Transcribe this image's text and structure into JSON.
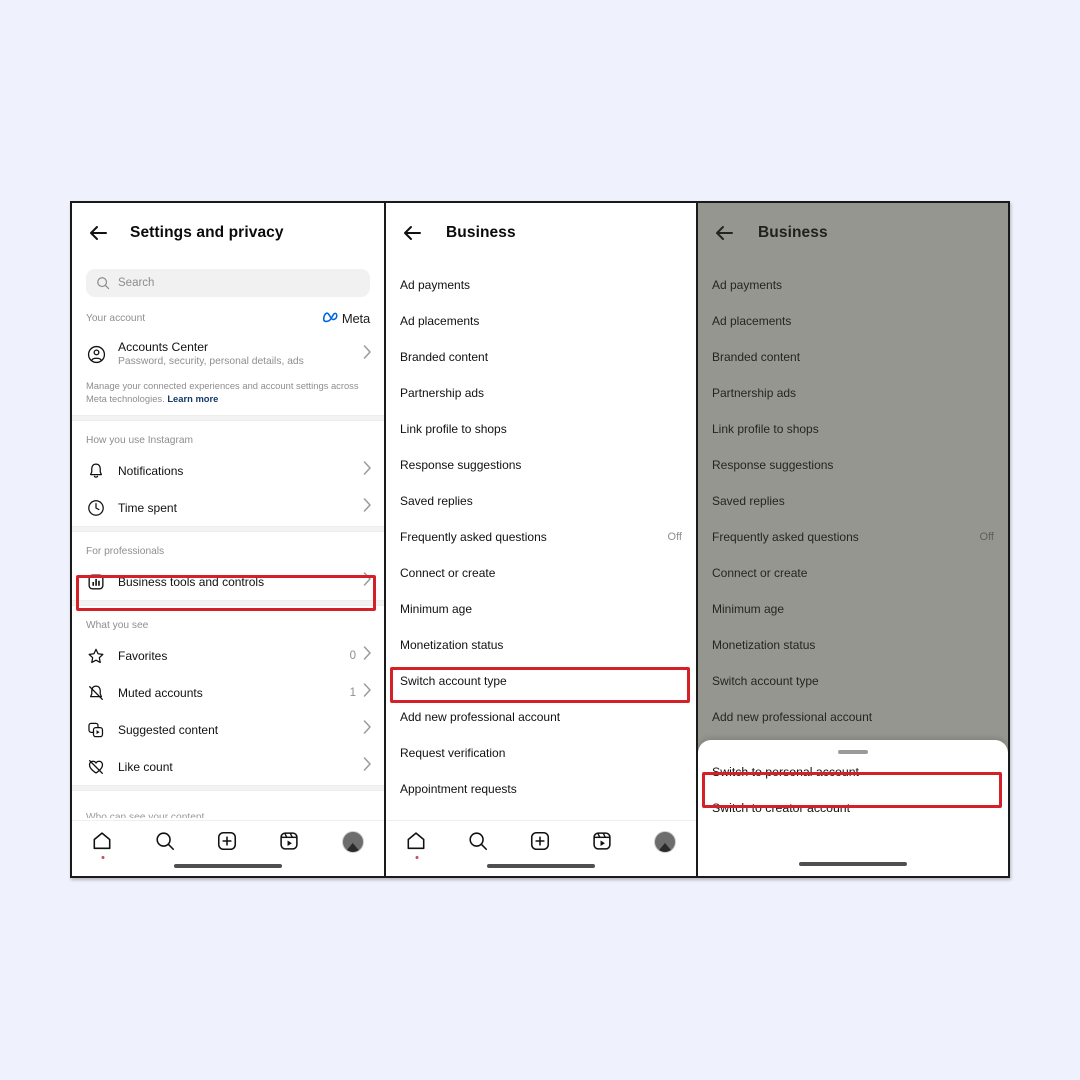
{
  "background_color": "#eff2fc",
  "accent_highlight_color": "#d42027",
  "meta_blue": "#0064e0",
  "panel1": {
    "header": {
      "title": "Settings and privacy",
      "back_icon": "back-arrow-icon"
    },
    "search": {
      "placeholder": "Search",
      "icon": "search-icon"
    },
    "section_account": {
      "label": "Your account",
      "brand": "Meta",
      "brand_icon": "meta-infinity-icon"
    },
    "accounts_center": {
      "icon": "account-circle-icon",
      "title": "Accounts Center",
      "subtitle": "Password, security, personal details, ads",
      "chevron": "chevron-right-icon"
    },
    "note": "Manage your connected experiences and account settings across Meta technologies.",
    "note_link": "Learn more",
    "section_usage": {
      "label": "How you use Instagram"
    },
    "usage_items": [
      {
        "label": "Notifications",
        "icon": "bell-icon",
        "meta": "",
        "chevron": "chevron-right-icon"
      },
      {
        "label": "Time spent",
        "icon": "clock-icon",
        "meta": "",
        "chevron": "chevron-right-icon"
      }
    ],
    "section_professionals": {
      "label": "For professionals"
    },
    "professional_items": [
      {
        "label": "Business tools and controls",
        "icon": "bar-chart-square-icon",
        "meta": "",
        "chevron": "chevron-right-icon",
        "highlighted": true
      }
    ],
    "section_whatyousee": {
      "label": "What you see"
    },
    "whatyousee_items": [
      {
        "label": "Favorites",
        "icon": "star-icon",
        "meta": "0",
        "chevron": "chevron-right-icon"
      },
      {
        "label": "Muted accounts",
        "icon": "bell-slash-icon",
        "meta": "1",
        "chevron": "chevron-right-icon"
      },
      {
        "label": "Suggested content",
        "icon": "suggested-content-icon",
        "meta": "",
        "chevron": "chevron-right-icon"
      },
      {
        "label": "Like count",
        "icon": "heart-slash-icon",
        "meta": "",
        "chevron": "chevron-right-icon"
      }
    ],
    "cut_off_section": "Who can see your content"
  },
  "panel2": {
    "header": {
      "title": "Business",
      "back_icon": "back-arrow-icon"
    },
    "items": [
      {
        "label": "Ad payments",
        "meta": ""
      },
      {
        "label": "Ad placements",
        "meta": ""
      },
      {
        "label": "Branded content",
        "meta": ""
      },
      {
        "label": "Partnership ads",
        "meta": ""
      },
      {
        "label": "Link profile to shops",
        "meta": ""
      },
      {
        "label": "Response suggestions",
        "meta": ""
      },
      {
        "label": "Saved replies",
        "meta": ""
      },
      {
        "label": "Frequently asked questions",
        "meta": "Off"
      },
      {
        "label": "Connect or create",
        "meta": ""
      },
      {
        "label": "Minimum age",
        "meta": ""
      },
      {
        "label": "Monetization status",
        "meta": ""
      },
      {
        "label": "Switch account type",
        "meta": "",
        "highlighted": true
      },
      {
        "label": "Add new professional account",
        "meta": ""
      },
      {
        "label": "Request verification",
        "meta": ""
      },
      {
        "label": "Appointment requests",
        "meta": ""
      }
    ]
  },
  "panel3": {
    "header": {
      "title": "Business",
      "back_icon": "back-arrow-icon"
    },
    "dimmed": true,
    "items": [
      {
        "label": "Ad payments",
        "meta": ""
      },
      {
        "label": "Ad placements",
        "meta": ""
      },
      {
        "label": "Branded content",
        "meta": ""
      },
      {
        "label": "Partnership ads",
        "meta": ""
      },
      {
        "label": "Link profile to shops",
        "meta": ""
      },
      {
        "label": "Response suggestions",
        "meta": ""
      },
      {
        "label": "Saved replies",
        "meta": ""
      },
      {
        "label": "Frequently asked questions",
        "meta": "Off"
      },
      {
        "label": "Connect or create",
        "meta": ""
      },
      {
        "label": "Minimum age",
        "meta": ""
      },
      {
        "label": "Monetization status",
        "meta": ""
      },
      {
        "label": "Switch account type",
        "meta": ""
      },
      {
        "label": "Add new professional account",
        "meta": ""
      }
    ],
    "sheet": {
      "handle": "drag-handle",
      "options": [
        {
          "label": "Switch to personal account",
          "highlighted": true
        },
        {
          "label": "Switch to creator account",
          "highlighted": false
        }
      ]
    }
  },
  "bottom_nav": {
    "items": [
      {
        "icon": "home-icon",
        "has_dot": true
      },
      {
        "icon": "search-icon",
        "has_dot": false
      },
      {
        "icon": "create-plus-icon",
        "has_dot": false
      },
      {
        "icon": "reels-icon",
        "has_dot": false
      },
      {
        "icon": "profile-avatar-icon",
        "has_dot": false
      }
    ]
  }
}
